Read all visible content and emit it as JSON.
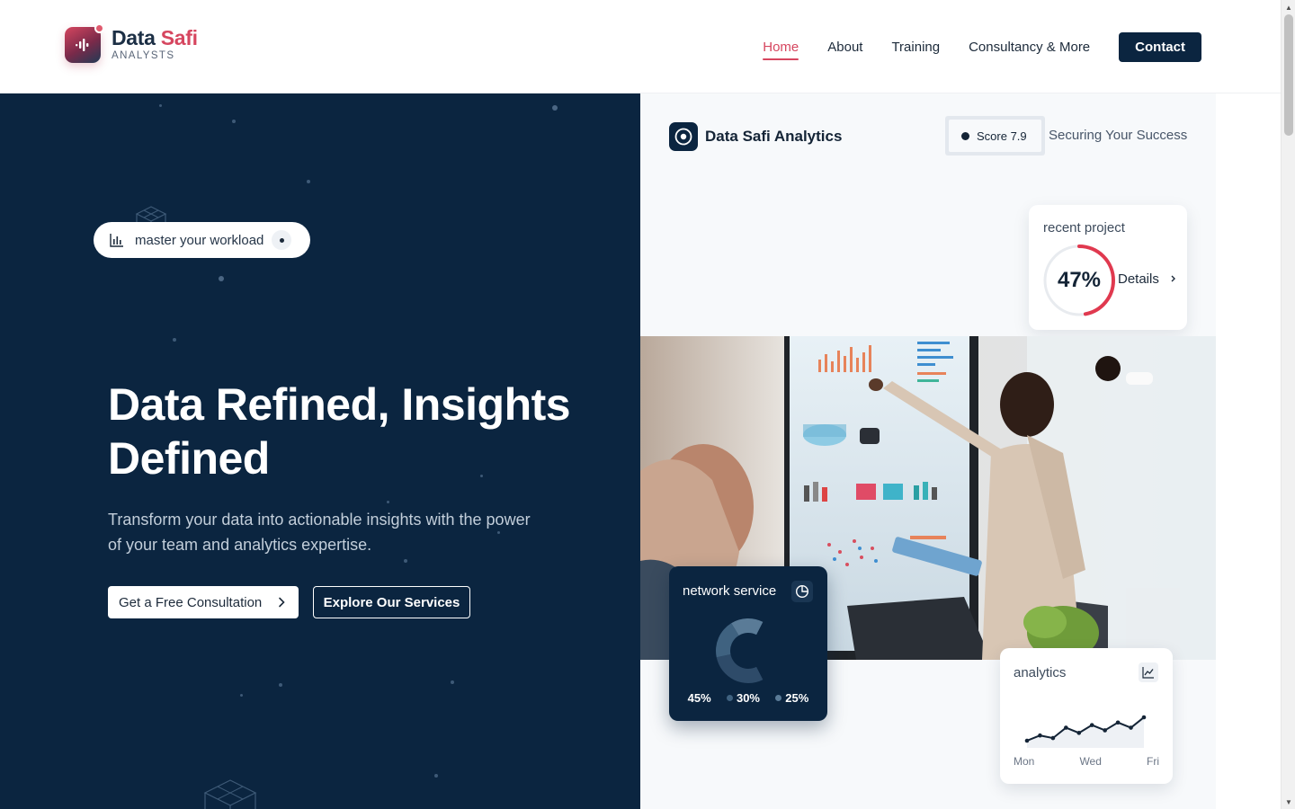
{
  "brand": {
    "name_part1": "Data",
    "name_part2": "Safi",
    "subtitle": "ANALYSTS",
    "accent_color": "#d6465f",
    "dark_color": "#0b2540"
  },
  "nav": {
    "items": [
      {
        "label": "Home",
        "active": true
      },
      {
        "label": "About"
      },
      {
        "label": "Training"
      },
      {
        "label": "Consultancy & More"
      }
    ],
    "contact_label": "Contact"
  },
  "hero": {
    "pill_text": "master your workload",
    "pill_icon": "bar-chart-icon",
    "title": "Data Refined, Insights Defined",
    "subtitle": "Transform your data into actionable insights with the power of your team and analytics expertise.",
    "primary_cta": "Get a Free Consultation",
    "secondary_cta": "Explore Our Services"
  },
  "panel": {
    "brand_name": "Data Safi Analytics",
    "score": "Score 7.9",
    "tagline": "Securing Your Success",
    "recent_project": {
      "label": "recent project",
      "value": "47%",
      "progress": 0.47,
      "link": "Details"
    },
    "network_service": {
      "label": "network service",
      "segments": [
        {
          "label": "45%",
          "value": 45,
          "color": "#2e4b69"
        },
        {
          "label": "30%",
          "value": 30,
          "color": "#3f6280"
        },
        {
          "label": "25%",
          "value": 25,
          "color": "#5a7b97"
        }
      ]
    },
    "analytics": {
      "label": "analytics",
      "axis_labels": [
        "Mon",
        "Wed",
        "Fri"
      ],
      "trend": [
        3,
        5,
        4,
        8,
        6,
        9,
        7,
        10,
        8,
        12
      ]
    }
  }
}
